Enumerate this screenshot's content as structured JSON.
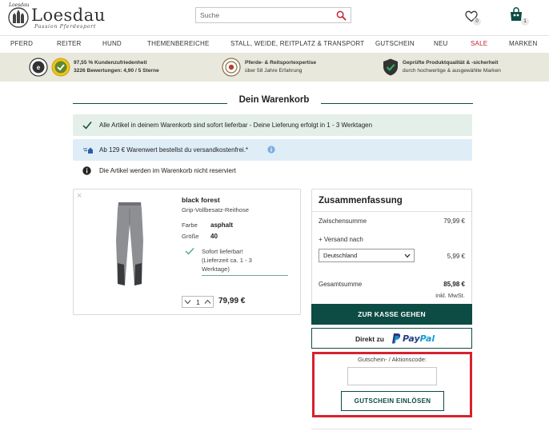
{
  "header": {
    "logo_small": "Loesdau",
    "logo_name": "Loesdau",
    "logo_tagline": "Passion Pferdesport",
    "search_placeholder": "Suche",
    "wishlist_count": "0",
    "cart_count": "1"
  },
  "nav": {
    "items": [
      "PFERD",
      "REITER",
      "HUND",
      "THEMENBEREICHE",
      "STALL, WEIDE, REITPLATZ & TRANSPORT",
      "GUTSCHEIN",
      "NEU",
      "SALE",
      "MARKEN"
    ],
    "sale_color": "#c52030"
  },
  "trust": {
    "rating_line1": "97,55 % Kundenzufriedenheit",
    "rating_line2": "3226 Bewertungen: 4,90 / 5 Sterne",
    "expertise_line1": "Pferde- & Reitsportexpertise",
    "expertise_line2": "über 58 Jahre Erfahrung",
    "quality_line1": "Geprüfte Produktqualität & -sicherheit",
    "quality_line2": "durch hochwertige & ausgewählte Marken"
  },
  "page": {
    "title": "Dein Warenkorb",
    "accent_color": "#0d4c44"
  },
  "notices": {
    "delivery": "Alle Artikel in deinem Warenkorb sind sofort lieferbar - Deine Lieferung erfolgt in 1 - 3 Werktagen",
    "shipping": "Ab 129 € Warenwert bestellst du versandkostenfrei.*",
    "reservation": "Die Artikel werden im Warenkorb nicht reserviert"
  },
  "product": {
    "remove": "×",
    "name": "black forest",
    "subtitle": "Grip-Vollbesatz-Reithose",
    "color_label": "Farbe",
    "color_value": "asphalt",
    "size_label": "Größe",
    "size_value": "40",
    "availability_line1": "Sofort lieferbar!",
    "availability_line2": "(Lieferzeit ca. 1 - 3",
    "availability_line3": "Werktage)",
    "quantity": "1",
    "price": "79,99 €"
  },
  "summary": {
    "title": "Zusammenfassung",
    "subtotal_label": "Zwischensumme",
    "subtotal_value": "79,99 €",
    "shipping_label": "+ Versand nach",
    "country": "Deutschland",
    "shipping_value": "5,99 €",
    "total_label": "Gesamtsumme",
    "total_value": "85,98 €",
    "vat_note": "inkl. MwSt.",
    "checkout_label": "ZUR KASSE GEHEN",
    "paypal_prefix": "Direkt zu",
    "paypal_pay": "Pay",
    "paypal_pal": "Pal"
  },
  "coupon": {
    "label": "Gutschein- / Aktionscode:",
    "input_value": "",
    "button_label": "GUTSCHEIN EINLÖSEN",
    "highlight_color": "#d9212e"
  }
}
